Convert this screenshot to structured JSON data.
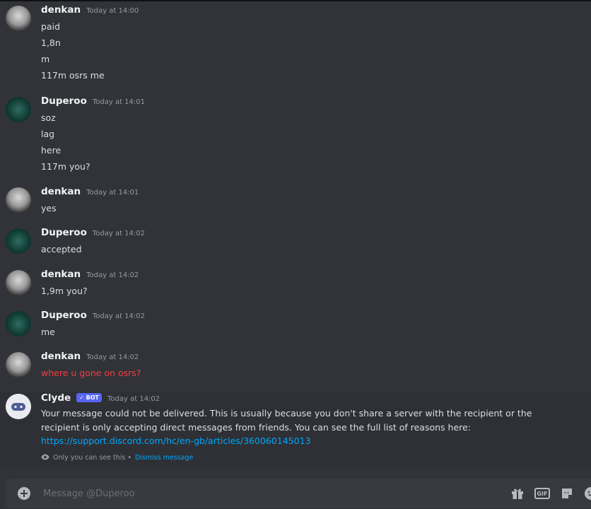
{
  "messages": [
    {
      "author": "denkan",
      "time": "Today at 14:00",
      "lines": [
        "paid",
        "1,8n",
        "m",
        "117m osrs me"
      ]
    },
    {
      "author": "Duperoo",
      "time": "Today at 14:01",
      "lines": [
        "soz",
        "lag",
        "here",
        "117m you?"
      ]
    },
    {
      "author": "denkan",
      "time": "Today at 14:01",
      "lines": [
        "yes"
      ]
    },
    {
      "author": "Duperoo",
      "time": "Today at 14:02",
      "lines": [
        "accepted"
      ]
    },
    {
      "author": "denkan",
      "time": "Today at 14:02",
      "lines": [
        "1,9m you?"
      ]
    },
    {
      "author": "Duperoo",
      "time": "Today at 14:02",
      "lines": [
        "me"
      ]
    },
    {
      "author": "denkan",
      "time": "Today at 14:02",
      "lines": [
        "where u gone on osrs?"
      ]
    }
  ],
  "clyde": {
    "author": "Clyde",
    "badge": "✓ BOT",
    "time": "Today at 14:02",
    "text": "Your message could not be delivered. This is usually because you don't share a server with the recipient or the recipient is only accepting direct messages from friends. You can see the full list of reasons here: ",
    "link": "https://support.discord.com/hc/en-gb/articles/360060145013",
    "note": "Only you can see this •",
    "dismiss": "Dismiss message"
  },
  "composer": {
    "placeholder": "Message @Duperoo",
    "gif_label": "GIF"
  },
  "icons": {
    "plus": "plus-icon",
    "gift": "gift-icon",
    "gif": "gif-icon",
    "sticker": "sticker-icon",
    "emoji": "emoji-icon",
    "eye": "eye-icon"
  },
  "colors": {
    "background": "#313338",
    "failed_message": "#f23f43",
    "link": "#00a8fc",
    "bot_badge": "#5865f2"
  }
}
